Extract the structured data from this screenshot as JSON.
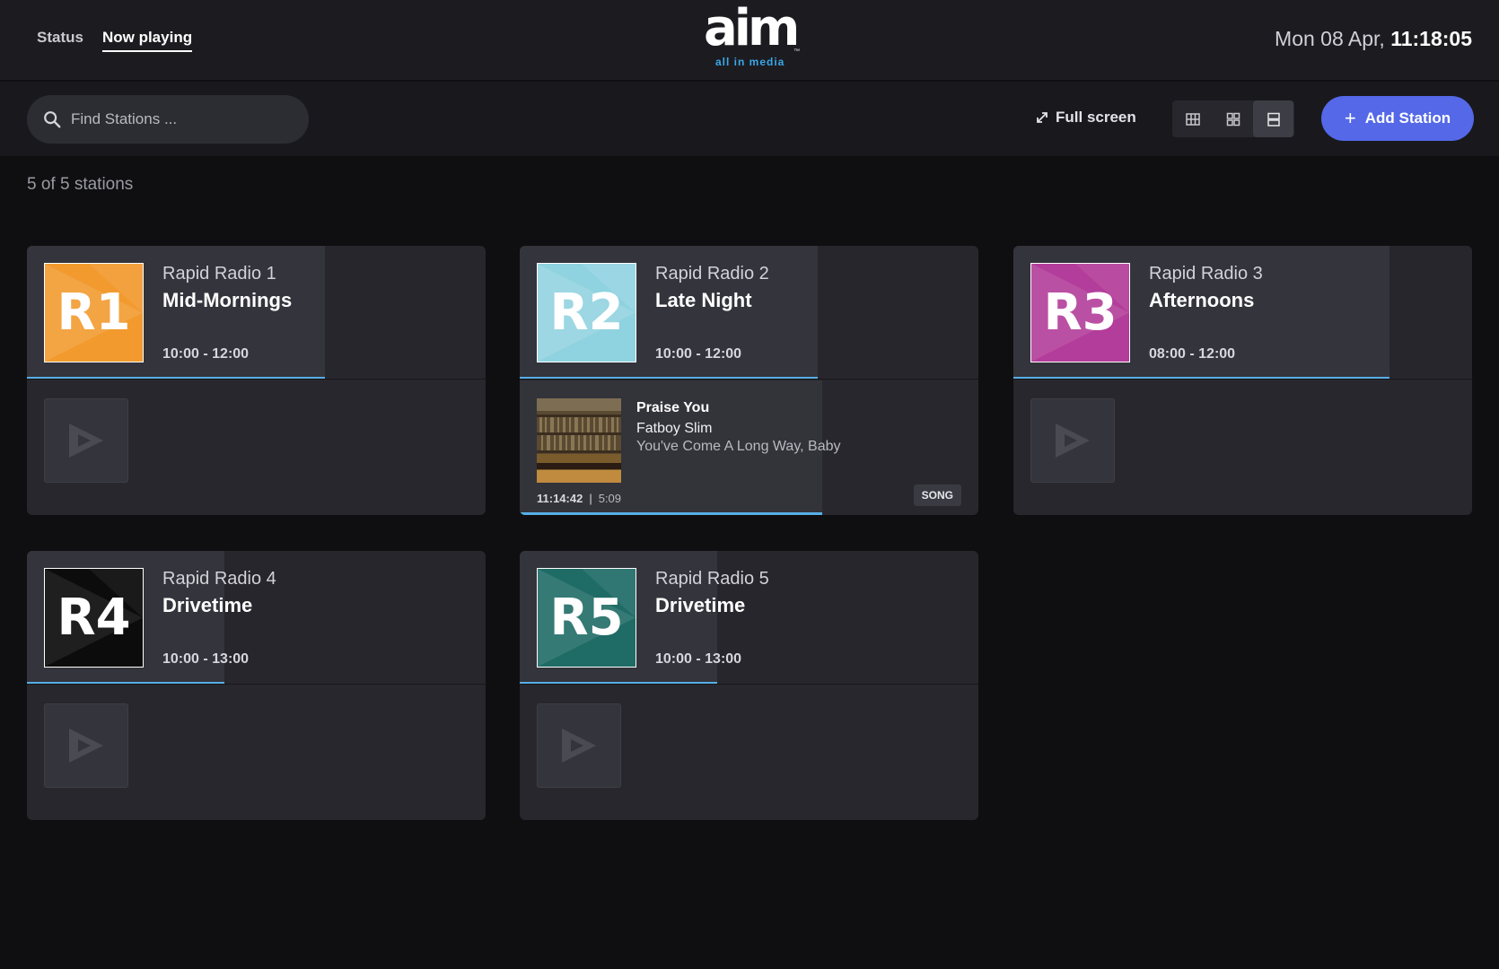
{
  "nav": {
    "status": "Status",
    "now_playing": "Now playing"
  },
  "logo": {
    "word": "aim",
    "tagline": "all in media",
    "tm": "™"
  },
  "clock": {
    "date": "Mon 08 Apr,",
    "time": "11:18:05"
  },
  "toolbar": {
    "search_placeholder": "Find Stations ...",
    "fullscreen_label": "Full screen",
    "add_label": "Add Station",
    "views": [
      "table-view",
      "grid-view",
      "list-view"
    ],
    "active_view": "list-view"
  },
  "count": "5 of 5 stations",
  "accent": "#58aee6",
  "stations": [
    {
      "logo": "R1",
      "logo_color": "#f29a2e",
      "name": "Rapid Radio 1",
      "show": "Mid-Mornings",
      "time": "10:00 - 12:00",
      "show_progress": 0.65
    },
    {
      "logo": "R2",
      "logo_color": "#8fd2e0",
      "name": "Rapid Radio 2",
      "show": "Late Night",
      "time": "10:00 - 12:00",
      "show_progress": 0.65,
      "now_playing": {
        "title": "Praise You",
        "artist": "Fatboy Slim",
        "album": "You've Come A Long Way, Baby",
        "start": "11:14:42",
        "duration": "5:09",
        "type": "SONG",
        "progress": 0.66
      }
    },
    {
      "logo": "R3",
      "logo_color": "#b33d9a",
      "name": "Rapid Radio 3",
      "show": "Afternoons",
      "time": "08:00 - 12:00",
      "show_progress": 0.82
    },
    {
      "logo": "R4",
      "logo_color": "#0c0c0c",
      "name": "Rapid Radio 4",
      "show": "Drivetime",
      "time": "10:00 - 13:00",
      "show_progress": 0.43
    },
    {
      "logo": "R5",
      "logo_color": "#1f6b66",
      "name": "Rapid Radio 5",
      "show": "Drivetime",
      "time": "10:00 - 13:00",
      "show_progress": 0.43
    }
  ]
}
